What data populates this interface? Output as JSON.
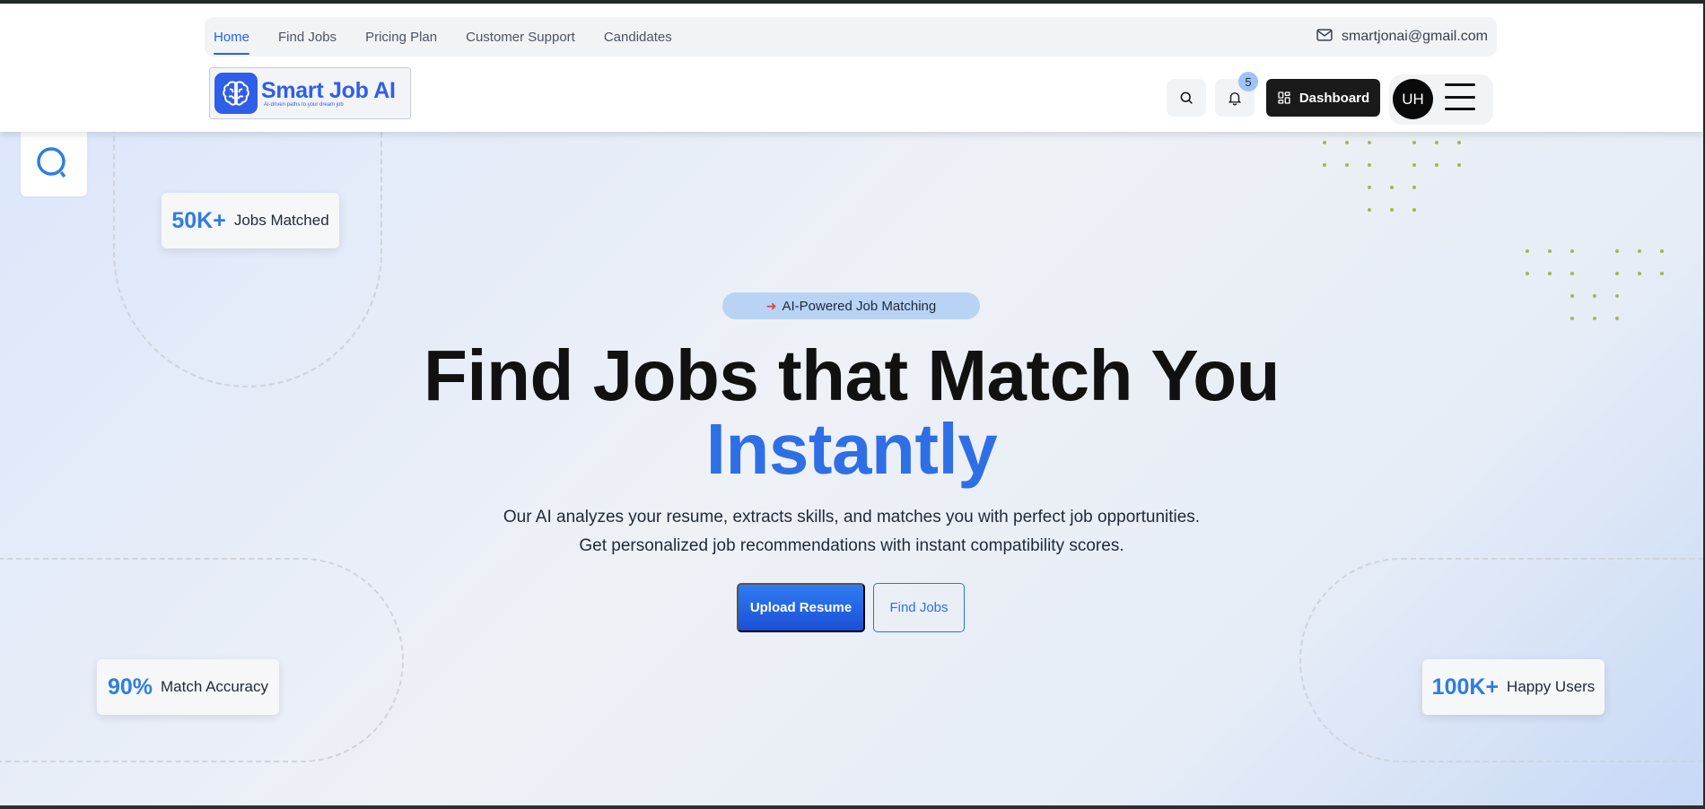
{
  "nav": {
    "links": [
      {
        "label": "Home",
        "active": true
      },
      {
        "label": "Find Jobs"
      },
      {
        "label": "Pricing Plan"
      },
      {
        "label": "Customer Support"
      },
      {
        "label": "Candidates"
      }
    ],
    "email": "smartjonai@gmail.com"
  },
  "brand": {
    "name": "Smart Job AI",
    "tagline": "AI-driven paths to your dream job",
    "color": "#2f5ee8"
  },
  "header_actions": {
    "notification_count": "5",
    "dashboard_label": "Dashboard",
    "avatar_initials": "UH"
  },
  "hero": {
    "badge": "AI-Powered Job Matching",
    "headline": "Find Jobs that Match You",
    "headline_accent": "Instantly",
    "description": "Our AI analyzes your resume, extracts skills, and matches you with perfect job opportunities. Get personalized job recommendations with instant compatibility scores.",
    "primary_cta": "Upload Resume",
    "secondary_cta": "Find Jobs"
  },
  "stats": [
    {
      "value": "50K+",
      "label": "Jobs Matched"
    },
    {
      "value": "90%",
      "label": "Match Accuracy"
    },
    {
      "value": "100K+",
      "label": "Happy Users"
    }
  ],
  "colors": {
    "accent": "#2563eb",
    "stat_number": "#2f7de0",
    "dark_button": "#1a1a1a"
  }
}
